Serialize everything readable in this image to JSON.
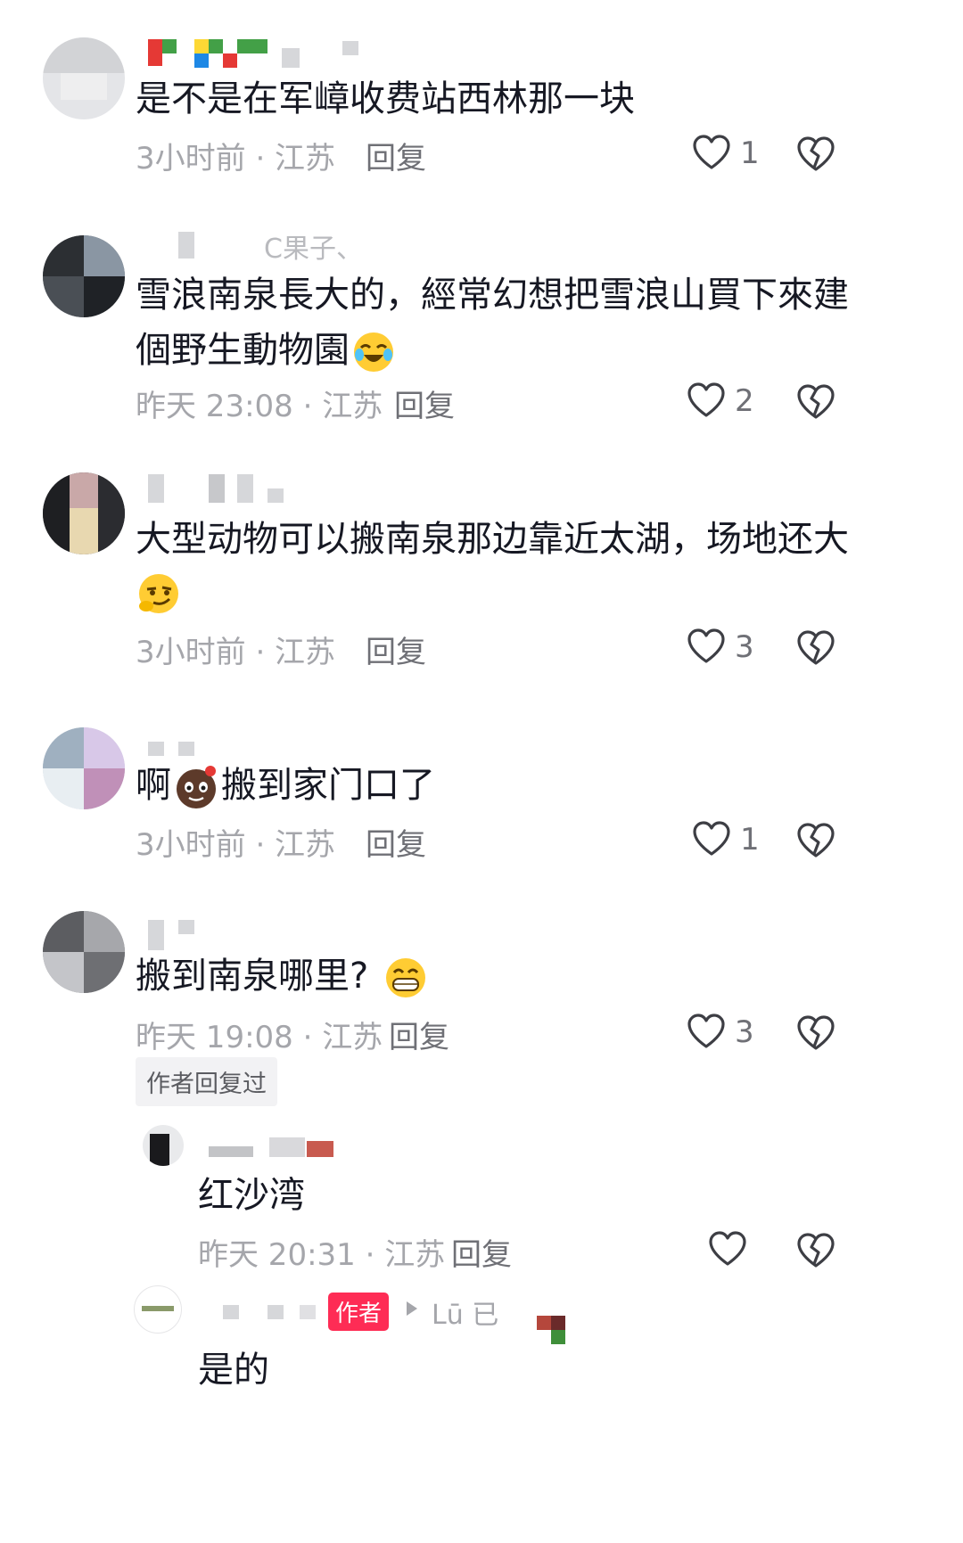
{
  "comments": [
    {
      "text": "是不是在军嶂收费站西林那一块",
      "meta": "3小时前 · 江苏",
      "reply_label": "回复",
      "likes": "1"
    },
    {
      "name": "C果子、",
      "text_line1": "雪浪南泉長大的，經常幻想把雪浪山買下來建",
      "text_line2": "個野生動物園",
      "meta": "昨天 23:08 · 江苏",
      "reply_label": "回复",
      "likes": "2"
    },
    {
      "text_line1": "大型动物可以搬南泉那边靠近太湖，场地还大",
      "meta": "3小时前 · 江苏",
      "reply_label": "回复",
      "likes": "3"
    },
    {
      "text_a": "啊",
      "text_b": "搬到家门口了",
      "meta": "3小时前 · 江苏",
      "reply_label": "回复",
      "likes": "1"
    },
    {
      "text": "搬到南泉哪里?",
      "meta": "昨天 19:08 · 江苏",
      "reply_label": "回复",
      "likes": "3",
      "author_replied": "作者回复过",
      "replies": [
        {
          "text": "红沙湾",
          "meta": "昨天 20:31 · 江苏",
          "reply_label": "回复"
        },
        {
          "badge": "作者",
          "name_fragment": "Lū 已",
          "text": "是的"
        }
      ]
    }
  ],
  "icons": {
    "like": "heart-outline-icon",
    "dislike": "broken-heart-icon"
  },
  "colors": {
    "text": "#161823",
    "meta": "#a5a6ab",
    "author_badge": "#fe2c55"
  }
}
